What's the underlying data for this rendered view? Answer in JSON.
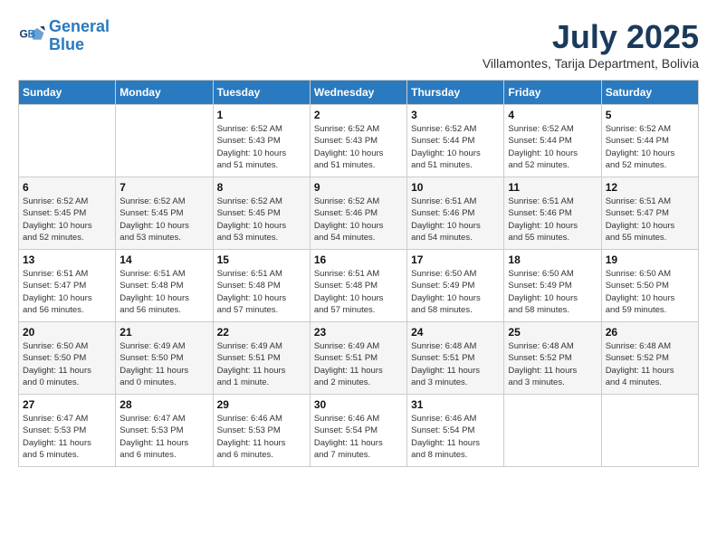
{
  "logo": {
    "line1": "General",
    "line2": "Blue"
  },
  "title": "July 2025",
  "subtitle": "Villamontes, Tarija Department, Bolivia",
  "weekdays": [
    "Sunday",
    "Monday",
    "Tuesday",
    "Wednesday",
    "Thursday",
    "Friday",
    "Saturday"
  ],
  "weeks": [
    [
      {
        "day": "",
        "detail": ""
      },
      {
        "day": "",
        "detail": ""
      },
      {
        "day": "1",
        "detail": "Sunrise: 6:52 AM\nSunset: 5:43 PM\nDaylight: 10 hours\nand 51 minutes."
      },
      {
        "day": "2",
        "detail": "Sunrise: 6:52 AM\nSunset: 5:43 PM\nDaylight: 10 hours\nand 51 minutes."
      },
      {
        "day": "3",
        "detail": "Sunrise: 6:52 AM\nSunset: 5:44 PM\nDaylight: 10 hours\nand 51 minutes."
      },
      {
        "day": "4",
        "detail": "Sunrise: 6:52 AM\nSunset: 5:44 PM\nDaylight: 10 hours\nand 52 minutes."
      },
      {
        "day": "5",
        "detail": "Sunrise: 6:52 AM\nSunset: 5:44 PM\nDaylight: 10 hours\nand 52 minutes."
      }
    ],
    [
      {
        "day": "6",
        "detail": "Sunrise: 6:52 AM\nSunset: 5:45 PM\nDaylight: 10 hours\nand 52 minutes."
      },
      {
        "day": "7",
        "detail": "Sunrise: 6:52 AM\nSunset: 5:45 PM\nDaylight: 10 hours\nand 53 minutes."
      },
      {
        "day": "8",
        "detail": "Sunrise: 6:52 AM\nSunset: 5:45 PM\nDaylight: 10 hours\nand 53 minutes."
      },
      {
        "day": "9",
        "detail": "Sunrise: 6:52 AM\nSunset: 5:46 PM\nDaylight: 10 hours\nand 54 minutes."
      },
      {
        "day": "10",
        "detail": "Sunrise: 6:51 AM\nSunset: 5:46 PM\nDaylight: 10 hours\nand 54 minutes."
      },
      {
        "day": "11",
        "detail": "Sunrise: 6:51 AM\nSunset: 5:46 PM\nDaylight: 10 hours\nand 55 minutes."
      },
      {
        "day": "12",
        "detail": "Sunrise: 6:51 AM\nSunset: 5:47 PM\nDaylight: 10 hours\nand 55 minutes."
      }
    ],
    [
      {
        "day": "13",
        "detail": "Sunrise: 6:51 AM\nSunset: 5:47 PM\nDaylight: 10 hours\nand 56 minutes."
      },
      {
        "day": "14",
        "detail": "Sunrise: 6:51 AM\nSunset: 5:48 PM\nDaylight: 10 hours\nand 56 minutes."
      },
      {
        "day": "15",
        "detail": "Sunrise: 6:51 AM\nSunset: 5:48 PM\nDaylight: 10 hours\nand 57 minutes."
      },
      {
        "day": "16",
        "detail": "Sunrise: 6:51 AM\nSunset: 5:48 PM\nDaylight: 10 hours\nand 57 minutes."
      },
      {
        "day": "17",
        "detail": "Sunrise: 6:50 AM\nSunset: 5:49 PM\nDaylight: 10 hours\nand 58 minutes."
      },
      {
        "day": "18",
        "detail": "Sunrise: 6:50 AM\nSunset: 5:49 PM\nDaylight: 10 hours\nand 58 minutes."
      },
      {
        "day": "19",
        "detail": "Sunrise: 6:50 AM\nSunset: 5:50 PM\nDaylight: 10 hours\nand 59 minutes."
      }
    ],
    [
      {
        "day": "20",
        "detail": "Sunrise: 6:50 AM\nSunset: 5:50 PM\nDaylight: 11 hours\nand 0 minutes."
      },
      {
        "day": "21",
        "detail": "Sunrise: 6:49 AM\nSunset: 5:50 PM\nDaylight: 11 hours\nand 0 minutes."
      },
      {
        "day": "22",
        "detail": "Sunrise: 6:49 AM\nSunset: 5:51 PM\nDaylight: 11 hours\nand 1 minute."
      },
      {
        "day": "23",
        "detail": "Sunrise: 6:49 AM\nSunset: 5:51 PM\nDaylight: 11 hours\nand 2 minutes."
      },
      {
        "day": "24",
        "detail": "Sunrise: 6:48 AM\nSunset: 5:51 PM\nDaylight: 11 hours\nand 3 minutes."
      },
      {
        "day": "25",
        "detail": "Sunrise: 6:48 AM\nSunset: 5:52 PM\nDaylight: 11 hours\nand 3 minutes."
      },
      {
        "day": "26",
        "detail": "Sunrise: 6:48 AM\nSunset: 5:52 PM\nDaylight: 11 hours\nand 4 minutes."
      }
    ],
    [
      {
        "day": "27",
        "detail": "Sunrise: 6:47 AM\nSunset: 5:53 PM\nDaylight: 11 hours\nand 5 minutes."
      },
      {
        "day": "28",
        "detail": "Sunrise: 6:47 AM\nSunset: 5:53 PM\nDaylight: 11 hours\nand 6 minutes."
      },
      {
        "day": "29",
        "detail": "Sunrise: 6:46 AM\nSunset: 5:53 PM\nDaylight: 11 hours\nand 6 minutes."
      },
      {
        "day": "30",
        "detail": "Sunrise: 6:46 AM\nSunset: 5:54 PM\nDaylight: 11 hours\nand 7 minutes."
      },
      {
        "day": "31",
        "detail": "Sunrise: 6:46 AM\nSunset: 5:54 PM\nDaylight: 11 hours\nand 8 minutes."
      },
      {
        "day": "",
        "detail": ""
      },
      {
        "day": "",
        "detail": ""
      }
    ]
  ]
}
